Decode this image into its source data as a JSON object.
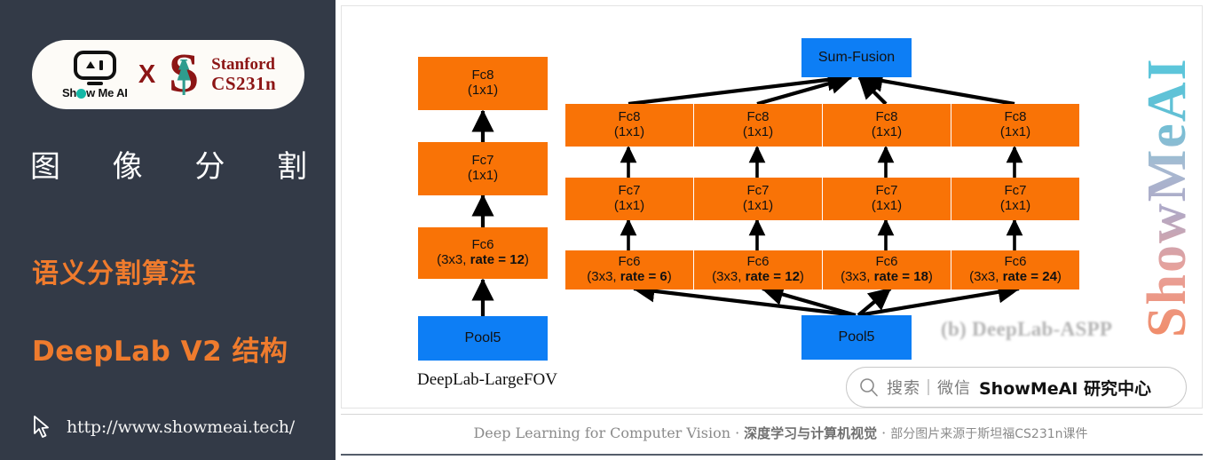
{
  "sidebar": {
    "logo": {
      "showmeai_word": "Show Me AI",
      "cross": "X",
      "stanford_line1": "Stanford",
      "stanford_line2": "CS231n"
    },
    "title_chars": [
      "图",
      "像",
      "分",
      "割"
    ],
    "subtitle_1": "语义分割算法",
    "subtitle_2": "DeepLab V2 结构",
    "url": "http://www.showmeai.tech/",
    "bg_color": "#333a47",
    "accent_color": "#ef7b2d"
  },
  "diagram": {
    "colors": {
      "orange": "#f97306",
      "blue": "#0d7ef5",
      "arrow": "#000000"
    },
    "largefov": {
      "caption": "DeepLab-LargeFOV",
      "nodes": [
        {
          "id": "lf-fc8",
          "line1": "Fc8",
          "line2": "(1x1)"
        },
        {
          "id": "lf-fc7",
          "line1": "Fc7",
          "line2": "(1x1)"
        },
        {
          "id": "lf-fc6",
          "line1": "Fc6",
          "line2_pre": "(3x3, ",
          "line2_bold": "rate = 12",
          "line2_post": ")"
        },
        {
          "id": "lf-pool5",
          "line1": "Pool5"
        }
      ]
    },
    "aspp": {
      "caption": "(b) DeepLab-ASPP",
      "fusion": "Sum-Fusion",
      "pool5": "Pool5",
      "branches": [
        {
          "fc8": "Fc8",
          "fc8_sub": "(1x1)",
          "fc7": "Fc7",
          "fc7_sub": "(1x1)",
          "fc6": "Fc6",
          "fc6_pre": "(3x3, ",
          "fc6_bold": "rate = 6",
          "fc6_post": ")"
        },
        {
          "fc8": "Fc8",
          "fc8_sub": "(1x1)",
          "fc7": "Fc7",
          "fc7_sub": "(1x1)",
          "fc6": "Fc6",
          "fc6_pre": "(3x3, ",
          "fc6_bold": "rate = 12",
          "fc6_post": ")"
        },
        {
          "fc8": "Fc8",
          "fc8_sub": "(1x1)",
          "fc7": "Fc7",
          "fc7_sub": "(1x1)",
          "fc6": "Fc6",
          "fc6_pre": "(3x3, ",
          "fc6_bold": "rate = 18",
          "fc6_post": ")"
        },
        {
          "fc8": "Fc8",
          "fc8_sub": "(1x1)",
          "fc7": "Fc7",
          "fc7_sub": "(1x1)",
          "fc6": "Fc6",
          "fc6_pre": "(3x3, ",
          "fc6_bold": "rate = 24",
          "fc6_post": ")"
        }
      ]
    }
  },
  "watermark": {
    "vertical_text": "ShowMeAI"
  },
  "search": {
    "prefix": "搜索｜微信",
    "brand": "ShowMeAI 研究中心"
  },
  "footer": {
    "en": "Deep Learning for Computer Vision",
    "sep": "·",
    "cn_bold": "深度学习与计算机视觉",
    "cn_tail": "部分图片来源于斯坦福CS231n课件"
  }
}
